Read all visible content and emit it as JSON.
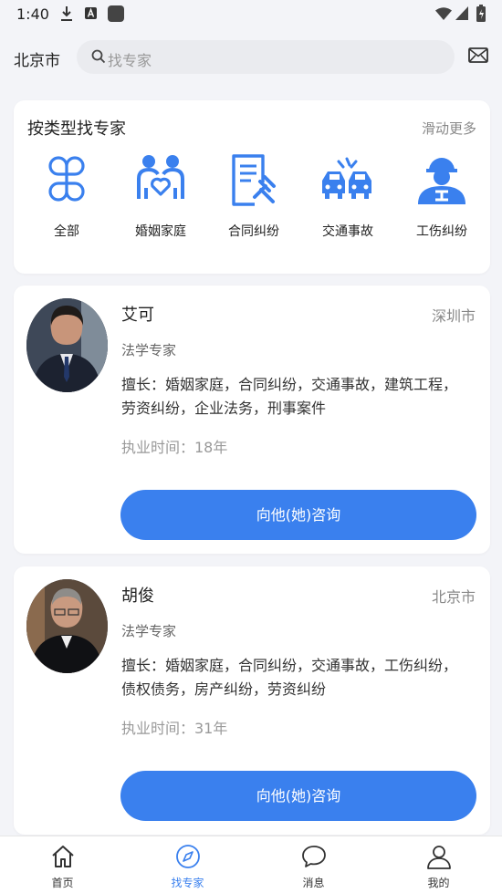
{
  "status_bar": {
    "time": "1:40"
  },
  "header": {
    "city": "北京市",
    "search_placeholder": "找专家"
  },
  "categories": {
    "title": "按类型找专家",
    "more": "滑动更多",
    "items": [
      {
        "label": "全部",
        "icon": "grid-icon"
      },
      {
        "label": "婚姻家庭",
        "icon": "family-heart-icon"
      },
      {
        "label": "合同纠纷",
        "icon": "contract-gavel-icon"
      },
      {
        "label": "交通事故",
        "icon": "car-crash-icon"
      },
      {
        "label": "工伤纠纷",
        "icon": "worker-icon"
      }
    ]
  },
  "experts": [
    {
      "name": "艾可",
      "location": "深圳市",
      "title": "法学专家",
      "skills": "擅长：婚姻家庭，合同纠纷，交通事故，建筑工程，劳资纠纷，企业法务，刑事案件",
      "years": "执业时间：18年",
      "button": "向他(她)咨询"
    },
    {
      "name": "胡俊",
      "location": "北京市",
      "title": "法学专家",
      "skills": "擅长：婚姻家庭，合同纠纷，交通事故，工伤纠纷，债权债务，房产纠纷，劳资纠纷",
      "years": "执业时间：31年",
      "button": "向他(她)咨询"
    }
  ],
  "bottom_nav": [
    {
      "label": "首页",
      "icon": "home-icon",
      "active": false
    },
    {
      "label": "找专家",
      "icon": "compass-icon",
      "active": true
    },
    {
      "label": "消息",
      "icon": "chat-icon",
      "active": false
    },
    {
      "label": "我的",
      "icon": "user-icon",
      "active": false
    }
  ],
  "colors": {
    "accent": "#3a80ee",
    "background": "#f3f4f8"
  }
}
